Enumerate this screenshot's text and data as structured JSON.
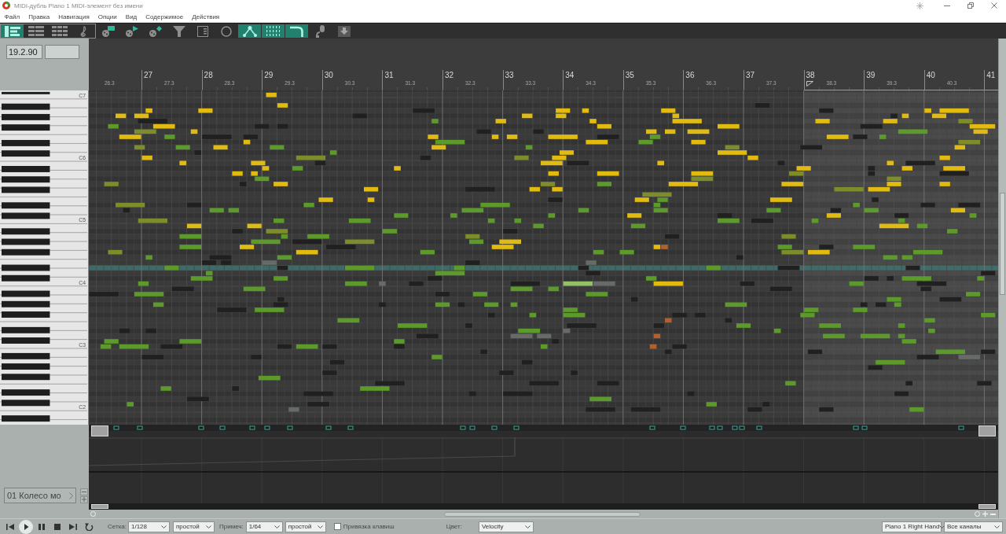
{
  "window": {
    "title": "MIDI-дубль Piano 1 MIDI-элемент без имени"
  },
  "menu": [
    "Файл",
    "Правка",
    "Навигация",
    "Опции",
    "Вид",
    "Содержимое",
    "Действия"
  ],
  "view_modes": [
    {
      "kind": "piano-roll",
      "selected": true
    },
    {
      "kind": "named-notes",
      "selected": false
    },
    {
      "kind": "event-list",
      "selected": false
    },
    {
      "kind": "notation",
      "selected": false
    }
  ],
  "toolbar": [
    {
      "kind": "insert",
      "selected": false
    },
    {
      "kind": "preview",
      "selected": false
    },
    {
      "kind": "step",
      "selected": false
    },
    {
      "kind": "filter",
      "selected": false
    },
    {
      "kind": "list",
      "selected": false
    },
    {
      "kind": "loop",
      "selected": false
    },
    {
      "kind": "nodes",
      "selected": true
    },
    {
      "kind": "grid",
      "selected": true
    },
    {
      "kind": "hook",
      "selected": true
    },
    {
      "kind": "mic",
      "selected": false
    },
    {
      "kind": "download",
      "selected": false
    }
  ],
  "position": {
    "value": "19.2.90"
  },
  "ruler": {
    "lead_label": "26.3",
    "measures": [
      {
        "label": "27",
        "beat_label": "27.3",
        "in_item": true
      },
      {
        "label": "28",
        "beat_label": "28.3",
        "in_item": true
      },
      {
        "label": "29",
        "beat_label": "29.3",
        "in_item": true
      },
      {
        "label": "30",
        "beat_label": "30.3",
        "in_item": true
      },
      {
        "label": "31",
        "beat_label": "31.3",
        "in_item": true
      },
      {
        "label": "32",
        "beat_label": "32.3",
        "in_item": true
      },
      {
        "label": "33",
        "beat_label": "33.3",
        "in_item": true
      },
      {
        "label": "34",
        "beat_label": "34.3",
        "in_item": true
      },
      {
        "label": "35",
        "beat_label": "35.3",
        "in_item": true
      },
      {
        "label": "36",
        "beat_label": "36.3",
        "in_item": true
      },
      {
        "label": "37",
        "beat_label": "37.3",
        "in_item": true
      },
      {
        "label": "38",
        "beat_label": "38.3",
        "in_item": false
      },
      {
        "label": "39",
        "beat_label": "39.3",
        "in_item": false
      },
      {
        "label": "40",
        "beat_label": "40.3",
        "in_item": false
      },
      {
        "label": "41",
        "in_item": false
      }
    ]
  },
  "keyboard": {
    "labels": [
      "C7",
      "C6",
      "C5",
      "C4",
      "C3",
      "C2"
    ]
  },
  "cc_lane": {
    "name": "01 Колесо мо"
  },
  "transport": [
    {
      "kind": "skip-back"
    },
    {
      "kind": "play"
    },
    {
      "kind": "pause"
    },
    {
      "kind": "stop"
    },
    {
      "kind": "skip-forward"
    },
    {
      "kind": "loop"
    }
  ],
  "grid_settings": {
    "label": "Сетка:",
    "value": "1/128",
    "mode": "простой"
  },
  "note_settings": {
    "label": "Примеч:",
    "value": "1/64",
    "mode": "простой"
  },
  "snap_keys": {
    "label": "Привязка клавиш",
    "checked": false
  },
  "color_settings": {
    "label": "Цвет:",
    "value": "Velocity"
  },
  "take": "Piano 1 Right Hand",
  "channels": "Все каналы"
}
